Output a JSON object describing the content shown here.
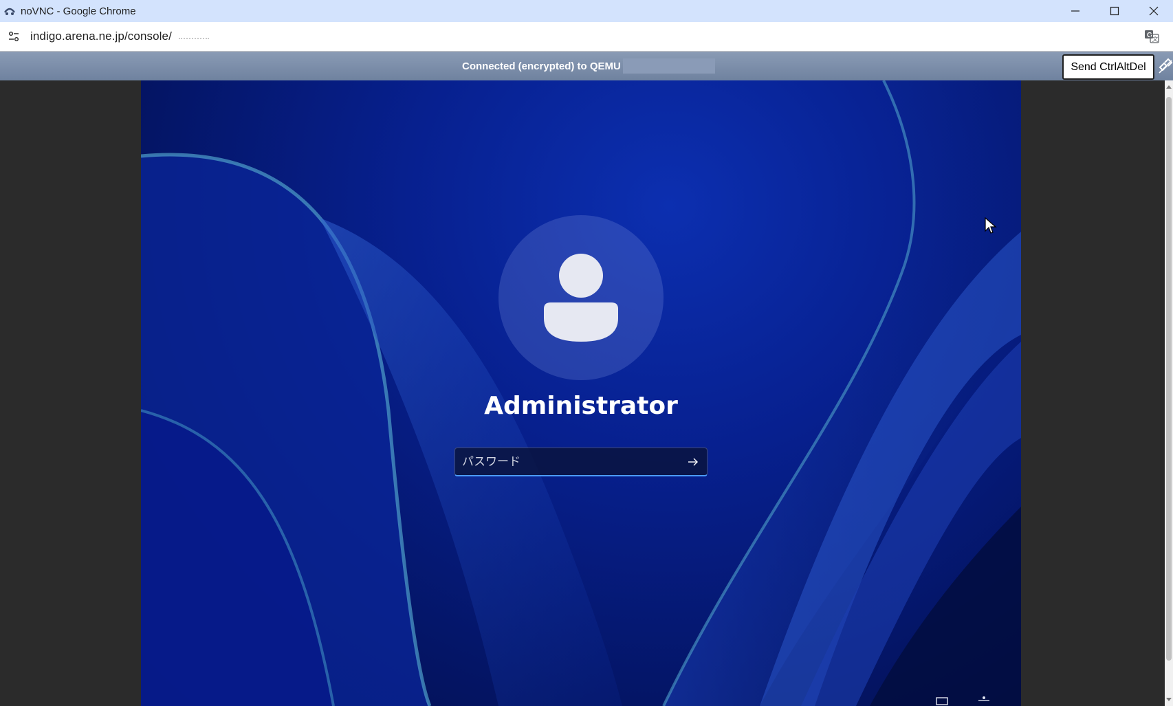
{
  "window": {
    "title": "noVNC - Google Chrome",
    "controls": [
      "minimize",
      "maximize",
      "close"
    ]
  },
  "addressbar": {
    "url": "indigo.arena.ne.jp/console/"
  },
  "novnc": {
    "status": "Connected (encrypted) to QEMU",
    "send_cad_label": "Send CtrlAltDel"
  },
  "login": {
    "user_name": "Administrator",
    "password_placeholder": "パスワード"
  },
  "icons": {
    "app": "novnc-icon",
    "site_info": "tune-icon",
    "translate": "translate-icon",
    "disconnect": "disconnect-icon",
    "avatar": "user-icon",
    "submit": "arrow-right-icon"
  },
  "colors": {
    "chrome_title_bg": "#d3e3fd",
    "novnc_bar": "#7b8daa",
    "wallpaper": "#07208f",
    "focus_underline": "#4c9bff"
  }
}
